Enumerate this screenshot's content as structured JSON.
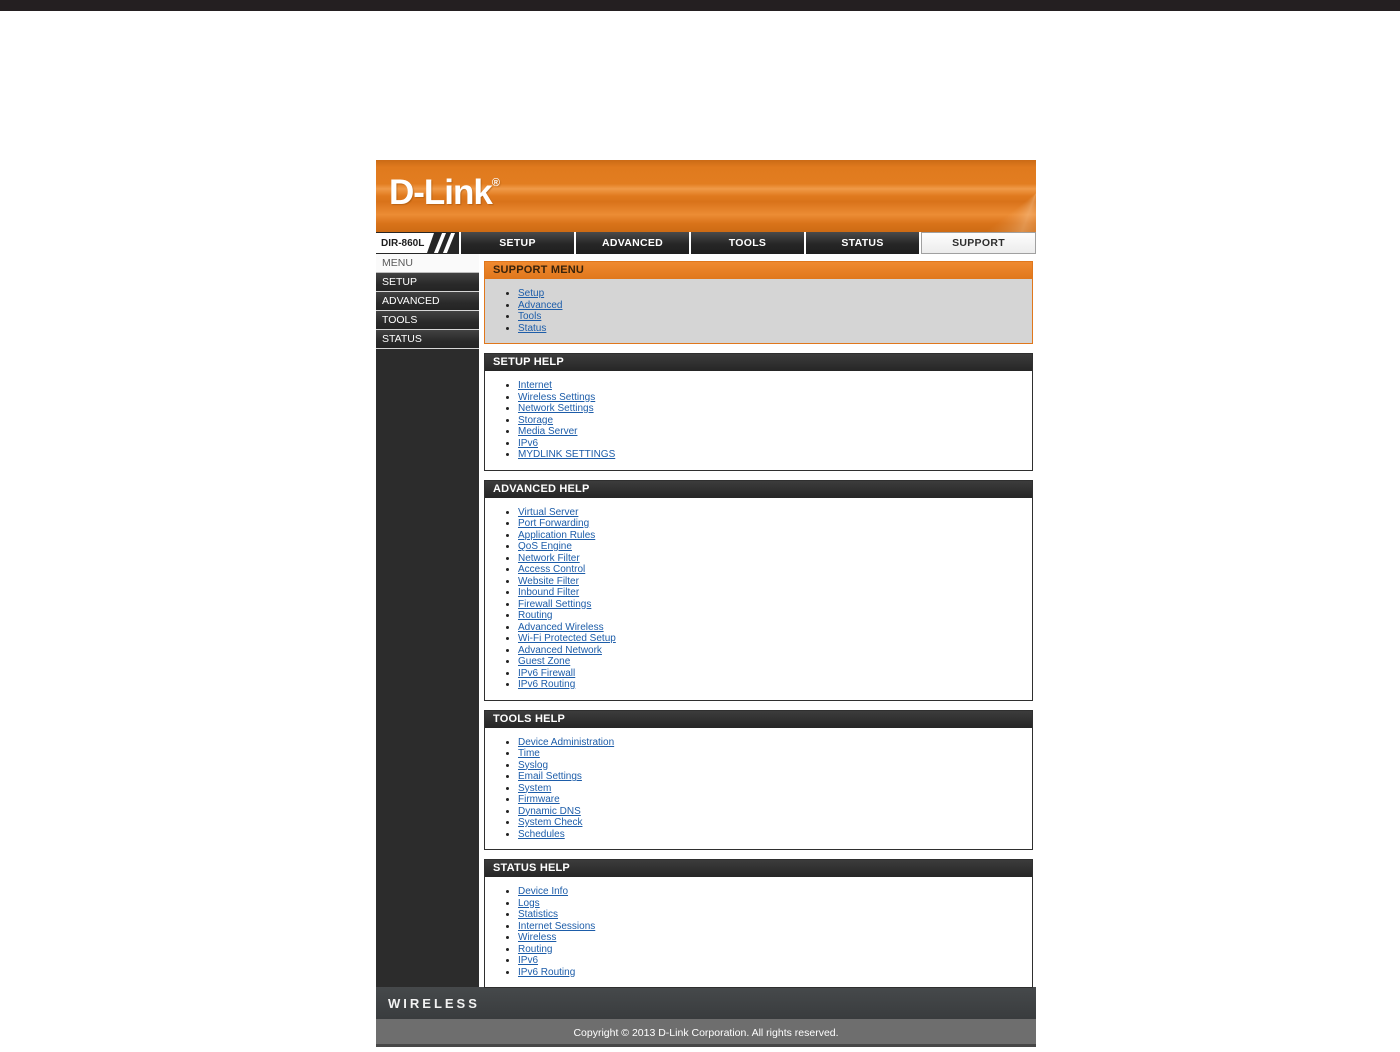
{
  "brand": {
    "logo": "D-Link",
    "registered": "®",
    "model": "DIR-860L"
  },
  "tabs": [
    {
      "label": "SETUP",
      "active": false
    },
    {
      "label": "ADVANCED",
      "active": false
    },
    {
      "label": "TOOLS",
      "active": false
    },
    {
      "label": "STATUS",
      "active": false
    },
    {
      "label": "SUPPORT",
      "active": true
    }
  ],
  "sidebar": {
    "items": [
      {
        "label": "MENU",
        "highlighted": true
      },
      {
        "label": "SETUP",
        "highlighted": false
      },
      {
        "label": "ADVANCED",
        "highlighted": false
      },
      {
        "label": "TOOLS",
        "highlighted": false
      },
      {
        "label": "STATUS",
        "highlighted": false
      }
    ]
  },
  "sections": [
    {
      "title": "SUPPORT MENU",
      "theme": "orange",
      "links": [
        "Setup",
        "Advanced",
        "Tools",
        "Status"
      ]
    },
    {
      "title": "SETUP HELP",
      "theme": "dark",
      "links": [
        "Internet",
        "Wireless Settings",
        "Network Settings",
        "Storage",
        "Media Server",
        "IPv6",
        "MYDLINK SETTINGS"
      ]
    },
    {
      "title": "ADVANCED HELP",
      "theme": "dark",
      "links": [
        "Virtual Server",
        "Port Forwarding",
        "Application Rules",
        "QoS Engine",
        "Network Filter",
        "Access Control",
        "Website Filter",
        "Inbound Filter",
        "Firewall Settings",
        "Routing",
        "Advanced Wireless",
        "Wi-Fi Protected Setup",
        "Advanced Network",
        "Guest Zone",
        "IPv6 Firewall",
        "IPv6 Routing"
      ]
    },
    {
      "title": "TOOLS HELP",
      "theme": "dark",
      "links": [
        "Device Administration",
        "Time",
        "Syslog",
        "Email Settings",
        "System",
        "Firmware",
        "Dynamic DNS",
        "System Check",
        "Schedules"
      ]
    },
    {
      "title": "STATUS HELP",
      "theme": "dark",
      "links": [
        "Device Info",
        "Logs",
        "Statistics",
        "Internet Sessions",
        "Wireless",
        "Routing",
        "IPv6",
        "IPv6 Routing"
      ]
    }
  ],
  "footer": {
    "wireless": "WIRELESS",
    "copyright": "Copyright © 2013 D-Link Corporation. All rights reserved."
  },
  "colors": {
    "banner_orange": "#e0771c",
    "link_blue": "#1d5da9",
    "dark_header": "#2b2b2b",
    "support_menu_body": "#d5d5d5"
  }
}
